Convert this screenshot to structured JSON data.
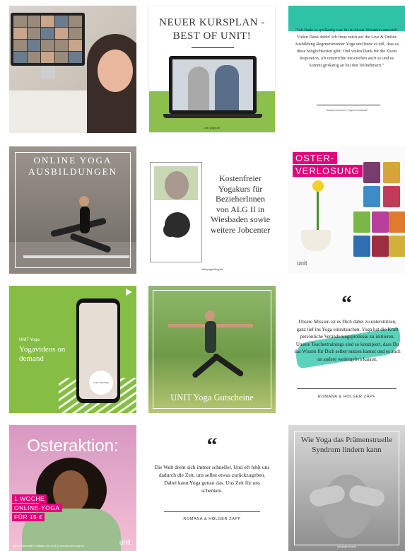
{
  "posts": [
    {
      "type": "photo"
    },
    {
      "title": "NEUER KURSPLAN - BEST OF UNIT!",
      "url": "unit-yoga.de",
      "accent": "#8dc04a"
    },
    {
      "testimonial": "\"Ich finde es großartig was ihr in dieser Situation umsetzt! Vielen Dank dafür! Ich freue mich auf die Live & Online Ausbildung Regenerierender Yoga und finde es toll, dass es diese Möglichkeiten gibt! Und vielen Dank für die Zoom Inspiration, ich unterrichte inzwischen auch so und es kommt großartig an bei den Teilnehmern.\"",
      "signature": "Jessica Hermann / Yoga in Innsbruck",
      "accent": "#2ec3a7"
    },
    {
      "title": "ONLINE YOGA AUSBILDUNGEN"
    },
    {
      "text": "Kostenfreier Yogakurs für BezieherInnen von ALG II in Wiesbaden sowie weitere Jobcenter",
      "url": "unit-yoga-blog.de"
    },
    {
      "line1": "OSTER-",
      "line2": "VERLOSUNG",
      "logo": "unit",
      "accent": "#e4007d"
    },
    {
      "brand": "UNIT Yoga",
      "title": "Yogavideos on demand",
      "phone_badge": "UNIT YOGA.DE",
      "accent": "#86bd45"
    },
    {
      "title": "UNIT Yoga Gutscheine"
    },
    {
      "quote_mark": "66",
      "text": "Unsere Mission ist es Dich dabei zu unterstützen, ganz tief ins Yoga einzutauchen. Yoga hat die Kraft persönliche Veränderungsprozesse zu initiieren. Unsere Teachertrainings sind so konzipiert, dass Du das Wissen für Dich selber nutzen kannst und es auch an andere weitergeben kannst.",
      "signature": "ROMANA & HOLGER ZAPF"
    },
    {
      "title": "Osteraktion:",
      "badge1": "1 WOCHE",
      "badge2": "ONLINE-YOGA",
      "badge3": "FÜR 15 €",
      "smalltext": "Nur für Neukunden. Einlösbar bis 06.04.21 auf www.unit-yoga.de",
      "logo": "unit"
    },
    {
      "quote_mark": "66",
      "text": "Die Welt dreht sich immer schneller. Und oft fehlt uns dadurch die Zeit, uns selbst etwas zurückzugeben. Dabei kann Yoga genau das. Uns Zeit für uns schenken.",
      "signature": "ROMANA & HOLGER ZAPF"
    },
    {
      "title": "Wie Yoga das Prämenstruelle Syndrom lindern kann",
      "url": "unit-yoga-blog.de"
    }
  ]
}
